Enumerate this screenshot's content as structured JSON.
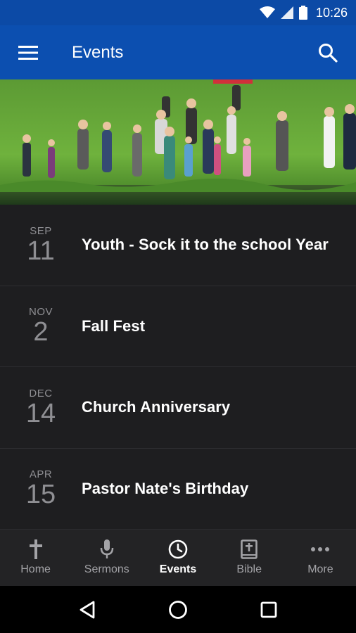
{
  "status": {
    "time": "10:26"
  },
  "app_bar": {
    "title": "Events"
  },
  "events": [
    {
      "month": "SEP",
      "day": "11",
      "title": "Youth - Sock it to the school Year"
    },
    {
      "month": "NOV",
      "day": "2",
      "title": "Fall Fest"
    },
    {
      "month": "DEC",
      "day": "14",
      "title": "Church Anniversary"
    },
    {
      "month": "APR",
      "day": "15",
      "title": "Pastor Nate's Birthday"
    }
  ],
  "bottom_nav": [
    {
      "label": "Home",
      "icon": "cross-icon",
      "active": false
    },
    {
      "label": "Sermons",
      "icon": "microphone-icon",
      "active": false
    },
    {
      "label": "Events",
      "icon": "clock-icon",
      "active": true
    },
    {
      "label": "Bible",
      "icon": "bible-icon",
      "active": false
    },
    {
      "label": "More",
      "icon": "more-dots-icon",
      "active": false
    }
  ],
  "colors": {
    "app_bar": "#0c4fb0",
    "status_bar": "#0c4aa6",
    "list_bg": "#1e1e20",
    "muted": "#8f8f93"
  }
}
